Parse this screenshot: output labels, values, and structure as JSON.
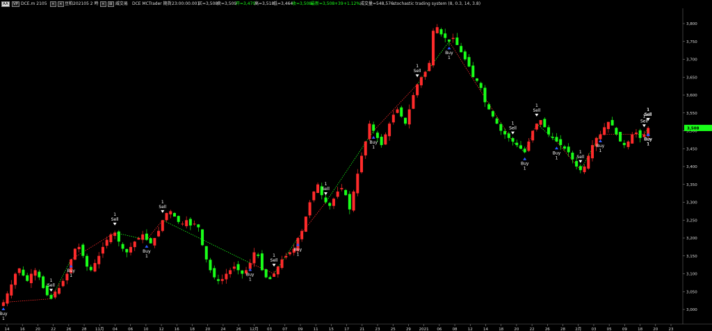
{
  "topbar": {
    "buttons": [
      "AA",
      "VP"
    ],
    "symbol": "DCE.m 2105",
    "period_box": "豆粕202105 2 時",
    "mid_label": "威交易",
    "source": "DCE  MCTrader  期貨",
    "time": "23:00:00.001",
    "bid": "买=3,508",
    "ask": "卖=3,509",
    "open": "开=3,470",
    "high": "高=3,518",
    "low": "低=3,464",
    "close": "收=3,508",
    "last": "最新=3,508",
    "change": "+39",
    "change_pct": "+1.12%",
    "volume": "成交量=548,576",
    "study": "stochastic trading system (8,  0.3,  14,  3.8)"
  },
  "price_axis": {
    "labels": [
      "3,800",
      "3,750",
      "3,700",
      "3,650",
      "3,600",
      "3,550",
      "3,500",
      "3,450",
      "3,400",
      "3,350",
      "3,300",
      "3,250",
      "3,200",
      "3,150",
      "3,100",
      "3,050",
      "3,000"
    ],
    "last_price": "3,508",
    "last_color": "#19ff19"
  },
  "time_axis": {
    "labels": [
      "14",
      "16",
      "20",
      "22",
      "26",
      "28",
      "11月",
      "04",
      "06",
      "10",
      "12",
      "16",
      "18",
      "20",
      "24",
      "26",
      "12月",
      "03",
      "07",
      "09",
      "11",
      "15",
      "17",
      "21",
      "23",
      "25",
      "29",
      "2021",
      "06",
      "08",
      "12",
      "14",
      "18",
      "20",
      "22",
      "26",
      "28",
      "2月",
      "03",
      "05",
      "09",
      "18",
      "20",
      "23"
    ]
  },
  "chart_data": {
    "type": "candlestick",
    "up_color": "#ff2b2b",
    "down_color": "#19ff19",
    "ylim": [
      2970,
      3820
    ],
    "close_path": [
      3020,
      3045,
      3070,
      3100,
      3115,
      3095,
      3080,
      3100,
      3110,
      3090,
      3060,
      3040,
      3030,
      3050,
      3060,
      3080,
      3100,
      3140,
      3170,
      3175,
      3150,
      3120,
      3110,
      3130,
      3150,
      3175,
      3195,
      3210,
      3215,
      3190,
      3170,
      3160,
      3175,
      3190,
      3200,
      3210,
      3195,
      3185,
      3200,
      3220,
      3250,
      3270,
      3275,
      3260,
      3245,
      3240,
      3250,
      3235,
      3240,
      3230,
      3180,
      3140,
      3110,
      3090,
      3080,
      3085,
      3100,
      3110,
      3120,
      3110,
      3100,
      3110,
      3130,
      3160,
      3150,
      3110,
      3090,
      3085,
      3100,
      3120,
      3140,
      3150,
      3160,
      3170,
      3200,
      3220,
      3260,
      3300,
      3330,
      3350,
      3320,
      3300,
      3290,
      3310,
      3330,
      3340,
      3320,
      3280,
      3330,
      3380,
      3430,
      3470,
      3520,
      3500,
      3480,
      3460,
      3490,
      3520,
      3545,
      3560,
      3540,
      3520,
      3560,
      3600,
      3630,
      3650,
      3665,
      3690,
      3780,
      3790,
      3770,
      3760,
      3750,
      3760,
      3740,
      3720,
      3700,
      3680,
      3650,
      3640,
      3620,
      3580,
      3560,
      3540,
      3520,
      3500,
      3490,
      3480,
      3470,
      3460,
      3450,
      3440,
      3470,
      3500,
      3520,
      3530,
      3510,
      3490,
      3480,
      3470,
      3460,
      3450,
      3440,
      3420,
      3400,
      3390,
      3400,
      3430,
      3460,
      3480,
      3490,
      3510,
      3525,
      3515,
      3490,
      3470,
      3460,
      3470,
      3490,
      3495,
      3480,
      3490,
      3508
    ],
    "signals": [
      {
        "type": "buy",
        "label": "Buy",
        "n": "1",
        "i": 0
      },
      {
        "type": "sell",
        "label": "Sell",
        "n": "1",
        "i": 12
      },
      {
        "type": "buy",
        "label": "Buy",
        "n": "1",
        "i": 17
      },
      {
        "type": "sell",
        "label": "Sell",
        "n": "1",
        "i": 28
      },
      {
        "type": "buy",
        "label": "Buy",
        "n": "1",
        "i": 36
      },
      {
        "type": "sell",
        "label": "Sell",
        "n": "1",
        "i": 40
      },
      {
        "type": "buy",
        "label": "Buy",
        "n": "1",
        "i": 62
      },
      {
        "type": "sell",
        "label": "Sell",
        "n": "1",
        "i": 68
      },
      {
        "type": "buy",
        "label": "Buy",
        "n": "1",
        "i": 74
      },
      {
        "type": "sell",
        "label": "Sell",
        "n": "1",
        "i": 81
      },
      {
        "type": "buy",
        "label": "Buy",
        "n": "1",
        "i": 93
      },
      {
        "type": "sell",
        "label": "Sell",
        "n": "1",
        "i": 104
      },
      {
        "type": "buy",
        "label": "Buy",
        "n": "1",
        "i": 112
      },
      {
        "type": "sell",
        "label": "Sell",
        "n": "1",
        "i": 128
      },
      {
        "type": "buy",
        "label": "Buy",
        "n": "1",
        "i": 131
      },
      {
        "type": "sell",
        "label": "Sell",
        "n": "1",
        "i": 134
      },
      {
        "type": "buy",
        "label": "Buy",
        "n": "1",
        "i": 139
      },
      {
        "type": "sell",
        "label": "Sell",
        "n": "1",
        "i": 145
      },
      {
        "type": "buy",
        "label": "Buy",
        "n": "1",
        "i": 150
      },
      {
        "type": "sell",
        "label": "Sell",
        "n": "1",
        "i": 161
      },
      {
        "type": "buy",
        "label": "Buy",
        "n": "1",
        "i": 170
      },
      {
        "type": "sell",
        "label": "Sell",
        "n": "1",
        "i": 176
      },
      {
        "type": "buy",
        "label": "Buy",
        "n": "1",
        "i": 184
      },
      {
        "type": "sell",
        "label": "Sell",
        "n": "1",
        "i": 190
      },
      {
        "type": "buy",
        "label": "Buy",
        "n": "1",
        "i": 196
      },
      {
        "type": "sell",
        "label": "Sell",
        "n": "1",
        "i": 203
      },
      {
        "type": "buy",
        "label": "Buy",
        "n": "1",
        "i": 210
      },
      {
        "type": "sell",
        "label": "Sell",
        "n": "1",
        "i": 218
      },
      {
        "type": "buy",
        "label": "Buy",
        "n": "1",
        "i": 224
      },
      {
        "type": "sell",
        "label": "Sell",
        "n": "1",
        "i": 229
      }
    ]
  }
}
